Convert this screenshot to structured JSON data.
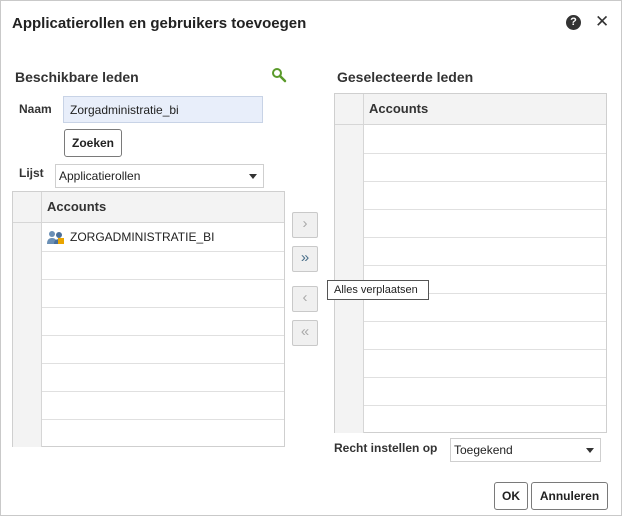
{
  "dialog": {
    "title": "Applicatierollen en gebruikers toevoegen",
    "help_glyph": "?",
    "close_glyph": "✕"
  },
  "available": {
    "title": "Beschikbare leden",
    "search_icon": "search-icon",
    "name_label": "Naam",
    "name_value": "Zorgadministratie_bi",
    "search_button": "Zoeken",
    "list_label": "Lijst",
    "list_value": "Applicatierollen",
    "column_header": "Accounts",
    "rows": [
      {
        "icon": "application-role-icon",
        "label": "ZORGADMINISTRATIE_BI"
      }
    ]
  },
  "shuttle": {
    "move": "›",
    "move_all": "»",
    "remove": "‹",
    "remove_all": "«",
    "tooltip": "Alles verplaatsen"
  },
  "selected": {
    "title": "Geselecteerde leden",
    "column_header": "Accounts",
    "permission_label": "Recht instellen op",
    "permission_value": "Toegekend"
  },
  "footer": {
    "ok": "OK",
    "cancel": "Annuleren"
  },
  "colors": {
    "input_background": "#e8eefa",
    "search_icon": "#5a9a2a",
    "shuttle_active": "#4a6f8a"
  }
}
